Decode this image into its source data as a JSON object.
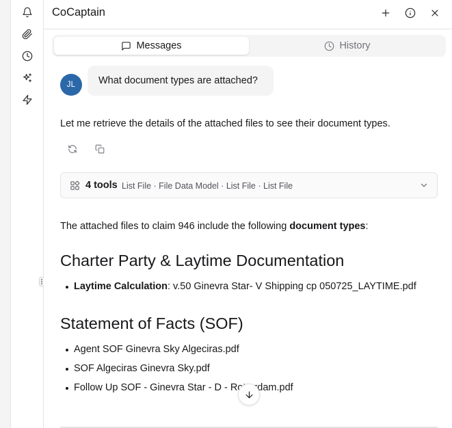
{
  "rail": {
    "icons": [
      "bell-icon",
      "paperclip-icon",
      "clock-icon",
      "sparkles-icon",
      "zap-icon"
    ]
  },
  "header": {
    "title": "CoCaptain",
    "icons": [
      "plus-icon",
      "info-icon",
      "close-icon"
    ]
  },
  "tabs": {
    "messages": "Messages",
    "history": "History"
  },
  "user_message": {
    "initials": "JL",
    "text": "What document types are attached?",
    "avatar_color": "#2b68a9"
  },
  "assistant": {
    "intro": "Let me retrieve the details of the attached files to see their document types.",
    "actions": [
      "refresh-icon",
      "copy-icon"
    ]
  },
  "tools": {
    "count_label": "4 tools",
    "list": "List File · File Data Model · List File · List File"
  },
  "answer": {
    "intro_prefix": "The attached files to claim 946 include the following ",
    "intro_bold": "document types",
    "intro_suffix": ":",
    "sections": [
      {
        "heading": "Charter Party & Laytime Documentation",
        "items": [
          {
            "label": "Laytime Calculation",
            "sep": ": ",
            "value": "v.50 Ginevra Star- V Shipping cp 050725_LAYTIME.pdf"
          }
        ]
      },
      {
        "heading": "Statement of Facts (SOF)",
        "items": [
          {
            "value": "Agent SOF Ginevra Sky Algeciras.pdf"
          },
          {
            "value": "SOF Algeciras Ginevra Sky.pdf"
          },
          {
            "value": "Follow Up SOF - Ginevra Star - D - Rotterdam.pdf"
          }
        ]
      }
    ]
  }
}
